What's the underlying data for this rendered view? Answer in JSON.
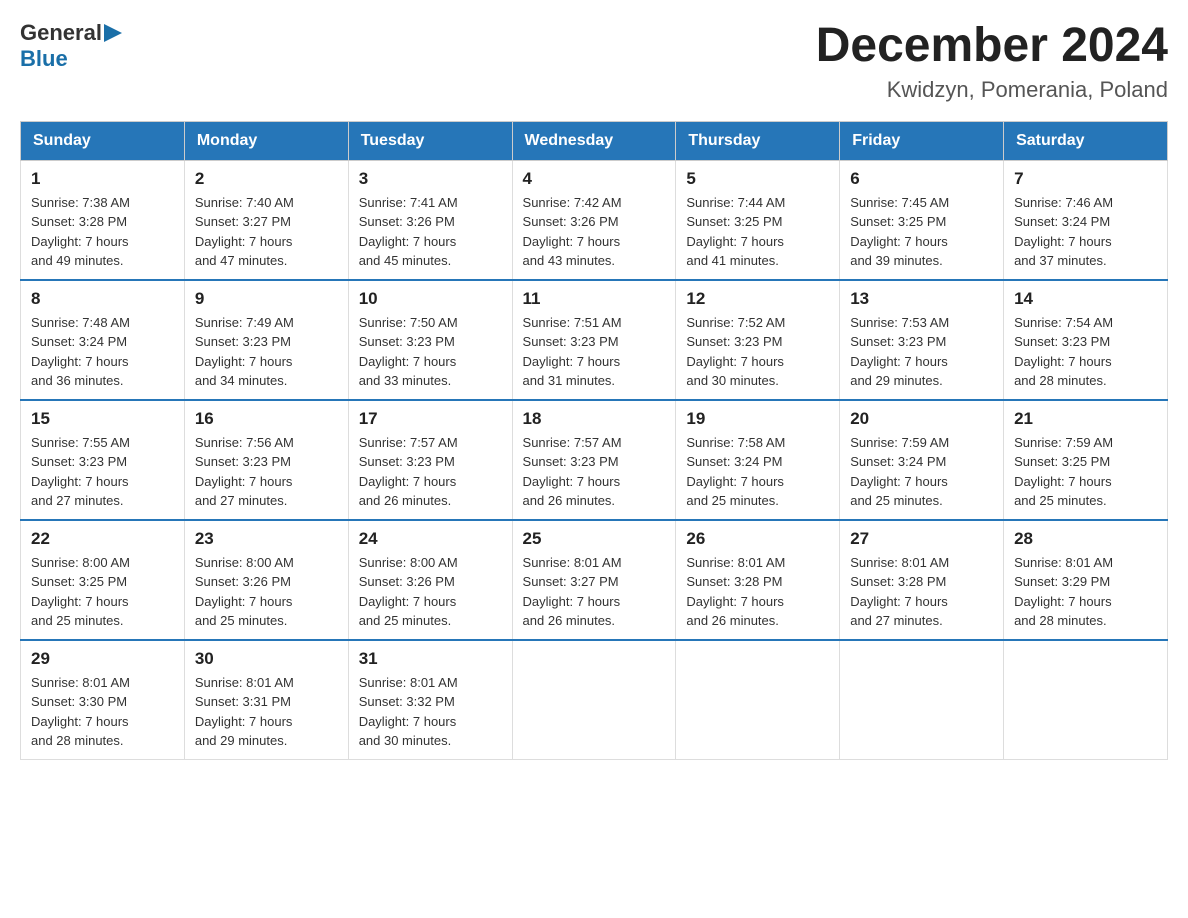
{
  "header": {
    "logo_general": "General",
    "logo_blue": "Blue",
    "month_title": "December 2024",
    "location": "Kwidzyn, Pomerania, Poland"
  },
  "days_of_week": [
    "Sunday",
    "Monday",
    "Tuesday",
    "Wednesday",
    "Thursday",
    "Friday",
    "Saturday"
  ],
  "weeks": [
    [
      {
        "day": "1",
        "sunrise": "7:38 AM",
        "sunset": "3:28 PM",
        "daylight": "7 hours and 49 minutes."
      },
      {
        "day": "2",
        "sunrise": "7:40 AM",
        "sunset": "3:27 PM",
        "daylight": "7 hours and 47 minutes."
      },
      {
        "day": "3",
        "sunrise": "7:41 AM",
        "sunset": "3:26 PM",
        "daylight": "7 hours and 45 minutes."
      },
      {
        "day": "4",
        "sunrise": "7:42 AM",
        "sunset": "3:26 PM",
        "daylight": "7 hours and 43 minutes."
      },
      {
        "day": "5",
        "sunrise": "7:44 AM",
        "sunset": "3:25 PM",
        "daylight": "7 hours and 41 minutes."
      },
      {
        "day": "6",
        "sunrise": "7:45 AM",
        "sunset": "3:25 PM",
        "daylight": "7 hours and 39 minutes."
      },
      {
        "day": "7",
        "sunrise": "7:46 AM",
        "sunset": "3:24 PM",
        "daylight": "7 hours and 37 minutes."
      }
    ],
    [
      {
        "day": "8",
        "sunrise": "7:48 AM",
        "sunset": "3:24 PM",
        "daylight": "7 hours and 36 minutes."
      },
      {
        "day": "9",
        "sunrise": "7:49 AM",
        "sunset": "3:23 PM",
        "daylight": "7 hours and 34 minutes."
      },
      {
        "day": "10",
        "sunrise": "7:50 AM",
        "sunset": "3:23 PM",
        "daylight": "7 hours and 33 minutes."
      },
      {
        "day": "11",
        "sunrise": "7:51 AM",
        "sunset": "3:23 PM",
        "daylight": "7 hours and 31 minutes."
      },
      {
        "day": "12",
        "sunrise": "7:52 AM",
        "sunset": "3:23 PM",
        "daylight": "7 hours and 30 minutes."
      },
      {
        "day": "13",
        "sunrise": "7:53 AM",
        "sunset": "3:23 PM",
        "daylight": "7 hours and 29 minutes."
      },
      {
        "day": "14",
        "sunrise": "7:54 AM",
        "sunset": "3:23 PM",
        "daylight": "7 hours and 28 minutes."
      }
    ],
    [
      {
        "day": "15",
        "sunrise": "7:55 AM",
        "sunset": "3:23 PM",
        "daylight": "7 hours and 27 minutes."
      },
      {
        "day": "16",
        "sunrise": "7:56 AM",
        "sunset": "3:23 PM",
        "daylight": "7 hours and 27 minutes."
      },
      {
        "day": "17",
        "sunrise": "7:57 AM",
        "sunset": "3:23 PM",
        "daylight": "7 hours and 26 minutes."
      },
      {
        "day": "18",
        "sunrise": "7:57 AM",
        "sunset": "3:23 PM",
        "daylight": "7 hours and 26 minutes."
      },
      {
        "day": "19",
        "sunrise": "7:58 AM",
        "sunset": "3:24 PM",
        "daylight": "7 hours and 25 minutes."
      },
      {
        "day": "20",
        "sunrise": "7:59 AM",
        "sunset": "3:24 PM",
        "daylight": "7 hours and 25 minutes."
      },
      {
        "day": "21",
        "sunrise": "7:59 AM",
        "sunset": "3:25 PM",
        "daylight": "7 hours and 25 minutes."
      }
    ],
    [
      {
        "day": "22",
        "sunrise": "8:00 AM",
        "sunset": "3:25 PM",
        "daylight": "7 hours and 25 minutes."
      },
      {
        "day": "23",
        "sunrise": "8:00 AM",
        "sunset": "3:26 PM",
        "daylight": "7 hours and 25 minutes."
      },
      {
        "day": "24",
        "sunrise": "8:00 AM",
        "sunset": "3:26 PM",
        "daylight": "7 hours and 25 minutes."
      },
      {
        "day": "25",
        "sunrise": "8:01 AM",
        "sunset": "3:27 PM",
        "daylight": "7 hours and 26 minutes."
      },
      {
        "day": "26",
        "sunrise": "8:01 AM",
        "sunset": "3:28 PM",
        "daylight": "7 hours and 26 minutes."
      },
      {
        "day": "27",
        "sunrise": "8:01 AM",
        "sunset": "3:28 PM",
        "daylight": "7 hours and 27 minutes."
      },
      {
        "day": "28",
        "sunrise": "8:01 AM",
        "sunset": "3:29 PM",
        "daylight": "7 hours and 28 minutes."
      }
    ],
    [
      {
        "day": "29",
        "sunrise": "8:01 AM",
        "sunset": "3:30 PM",
        "daylight": "7 hours and 28 minutes."
      },
      {
        "day": "30",
        "sunrise": "8:01 AM",
        "sunset": "3:31 PM",
        "daylight": "7 hours and 29 minutes."
      },
      {
        "day": "31",
        "sunrise": "8:01 AM",
        "sunset": "3:32 PM",
        "daylight": "7 hours and 30 minutes."
      },
      null,
      null,
      null,
      null
    ]
  ],
  "labels": {
    "sunrise": "Sunrise:",
    "sunset": "Sunset:",
    "daylight": "Daylight:"
  }
}
